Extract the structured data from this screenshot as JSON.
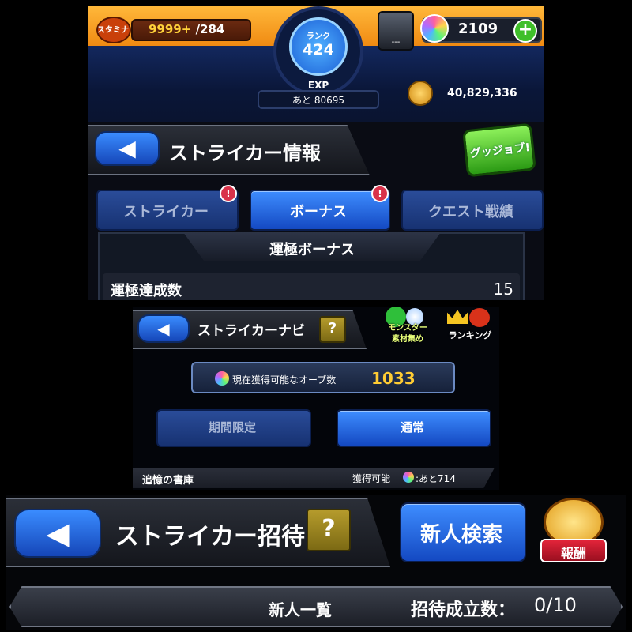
{
  "top_bar": {
    "stamina_label": "スタミナ",
    "stamina_value": "9999+",
    "stamina_max": "/284",
    "rank_label": "ランク",
    "rank_value": "424",
    "exp_label": "EXP",
    "exp_remaining": "あと 80695",
    "box_label": "---",
    "orbs": "2109",
    "coins": "40,829,336"
  },
  "striker_info": {
    "title": "ストライカー情報",
    "good_job_label": "グッジョブ!",
    "tabs": [
      {
        "label": "ストライカー",
        "active": false
      },
      {
        "label": "ボーナス",
        "active": true
      },
      {
        "label": "クエスト戦績",
        "active": false
      }
    ],
    "section_title": "運極ボーナス",
    "row_label": "運極達成数",
    "row_value": "15"
  },
  "striker_navi": {
    "title": "ストライカーナビ",
    "help": "?",
    "icon1_line1": "モンスター",
    "icon1_line2": "素材集め",
    "icon2_label": "ランキング",
    "orb_label": "現在獲得可能なオーブ数",
    "orb_value": "1033",
    "btn_limited": "期間限定",
    "btn_normal": "通常",
    "list_item_name": "追憶の書庫",
    "list_item_reward": "獲得可能",
    "list_item_remaining": ":あと714"
  },
  "striker_invite": {
    "title": "ストライカー招待",
    "help": "?",
    "search_button": "新人検索",
    "reward_label": "報酬",
    "list_title": "新人一覧",
    "count_label": "招待成立数：",
    "count_value": "0/10"
  },
  "colors": {
    "accent_blue": "#1e63e6",
    "orange": "#f6a021",
    "gold_text": "#ffcc33"
  }
}
